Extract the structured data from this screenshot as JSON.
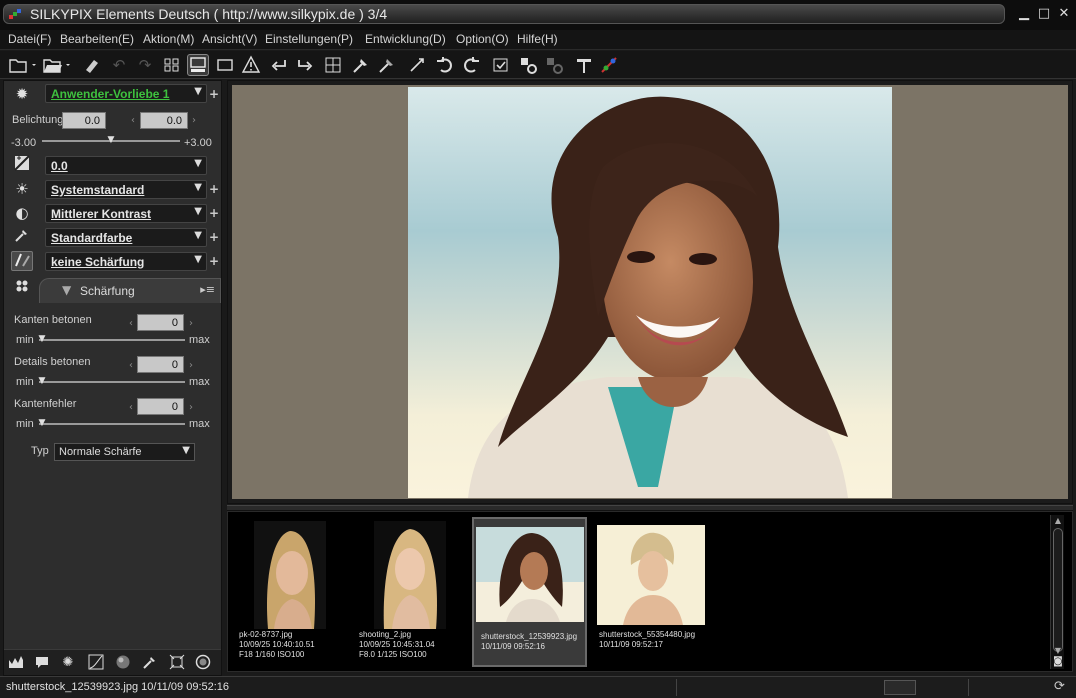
{
  "window": {
    "title": "SILKYPIX Elements Deutsch ( http://www.silkypix.de )   3/4",
    "minimize": "▁",
    "maximize": "□",
    "close": "✕"
  },
  "menu": [
    "Datei(F)",
    "Bearbeiten(E)",
    "Aktion(M)",
    "Ansicht(V)",
    "Einstellungen(P)",
    "Entwicklung(D)",
    "Option(O)",
    "Hilfe(H)"
  ],
  "toolbar_icons": [
    "open-folder-icon",
    "open-folder-menu-icon",
    "eraser-icon",
    "undo-icon",
    "redo-icon",
    "grid-view-icon",
    "preview-thumbnail-view-icon",
    "single-view-icon",
    "warning-icon",
    "previous-icon",
    "next-icon",
    "compare-icon",
    "white-balance-picker-icon",
    "gray-picker-icon",
    "rotate-tool-icon",
    "rotate-left-icon",
    "rotate-right-icon",
    "mark-icon",
    "develop-icon",
    "batch-develop-icon",
    "hammer-icon",
    "color-icon"
  ],
  "left_panel": {
    "preset": "Anwender-Vorliebe  1",
    "exposure": {
      "label": "Belichtung",
      "value1": "0.0",
      "value2": "0.0",
      "min": "-3.00",
      "max": "+3.00",
      "level": 0.5
    },
    "curve_value": "0.0",
    "white_balance": "Systemstandard",
    "contrast": "Mittlerer Kontrast",
    "color": "Standardfarbe",
    "sharpness": "keine Schärfung",
    "sharpening_tab": {
      "title": "Schärfung",
      "edges": {
        "label": "Kanten betonen",
        "value": "0"
      },
      "details": {
        "label": "Details betonen",
        "value": "0"
      },
      "edge_error": {
        "label": "Kantenfehler",
        "value": "0"
      },
      "min_label": "min",
      "max_label": "max",
      "type_label": "Typ",
      "type_value": "Normale Schärfe"
    }
  },
  "thumbnails": [
    {
      "name": "pk-02-8737.jpg",
      "date": "10/09/25 10:40:10.51",
      "info": "F18 1/160 ISO100",
      "selected": false
    },
    {
      "name": "shooting_2.jpg",
      "date": "10/09/25 10:45:31.04",
      "info": "F8.0 1/125 ISO100",
      "selected": false
    },
    {
      "name": "shutterstock_12539923.jpg",
      "date": "10/11/09 09:52:16",
      "info": "",
      "selected": true
    },
    {
      "name": "shutterstock_55354480.jpg",
      "date": "10/11/09 09:52:17",
      "info": "",
      "selected": false
    }
  ],
  "status": {
    "text": "shutterstock_12539923.jpg 10/11/09 09:52:16"
  },
  "colors": {
    "accent_green": "#3ec13e",
    "preview_bg": "#7c7466"
  }
}
